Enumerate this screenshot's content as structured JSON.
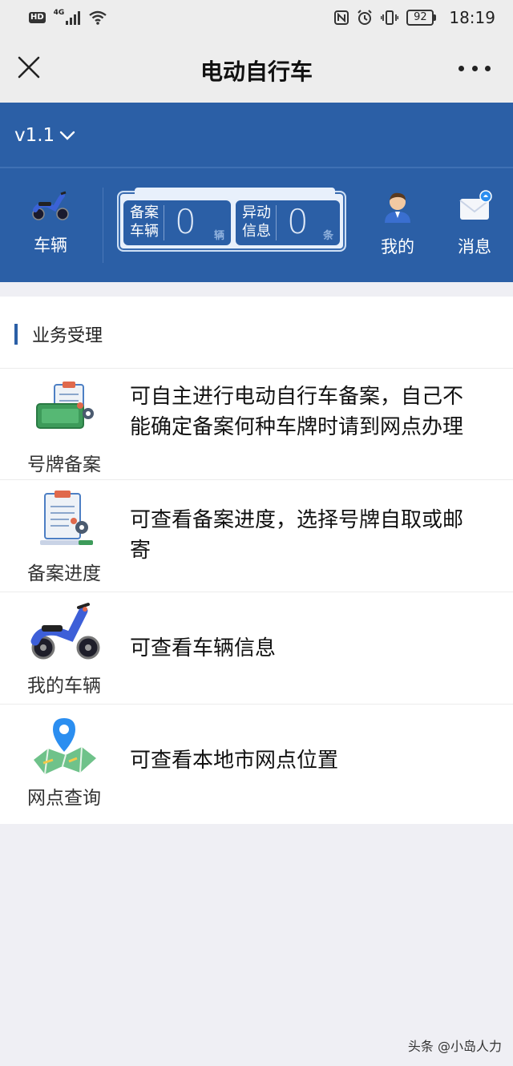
{
  "status_bar": {
    "hd": "HD",
    "network": "4G",
    "battery": "92",
    "time": "18:19"
  },
  "title_bar": {
    "title": "电动自行车"
  },
  "header": {
    "version": "v1.1",
    "vehicle_label": "车辆",
    "counters": [
      {
        "label": "备案车辆",
        "value": "0",
        "unit": "辆"
      },
      {
        "label": "异动信息",
        "value": "0",
        "unit": "条"
      }
    ],
    "mine_label": "我的",
    "messages_label": "消息"
  },
  "section": {
    "title": "业务受理"
  },
  "services": [
    {
      "name": "号牌备案",
      "description": "可自主进行电动自行车备案，自己不能确定备案何种车牌时请到网点办理",
      "icon": "plate-register-icon"
    },
    {
      "name": "备案进度",
      "description": "可查看备案进度，选择号牌自取或邮寄",
      "icon": "clipboard-progress-icon"
    },
    {
      "name": "我的车辆",
      "description": "可查看车辆信息",
      "icon": "scooter-icon"
    },
    {
      "name": "网点查询",
      "description": "可查看本地市网点位置",
      "icon": "map-pin-icon"
    }
  ],
  "watermark": "头条 @小岛人力",
  "colors": {
    "primary": "#2b5fa6",
    "background": "#efeff4"
  }
}
